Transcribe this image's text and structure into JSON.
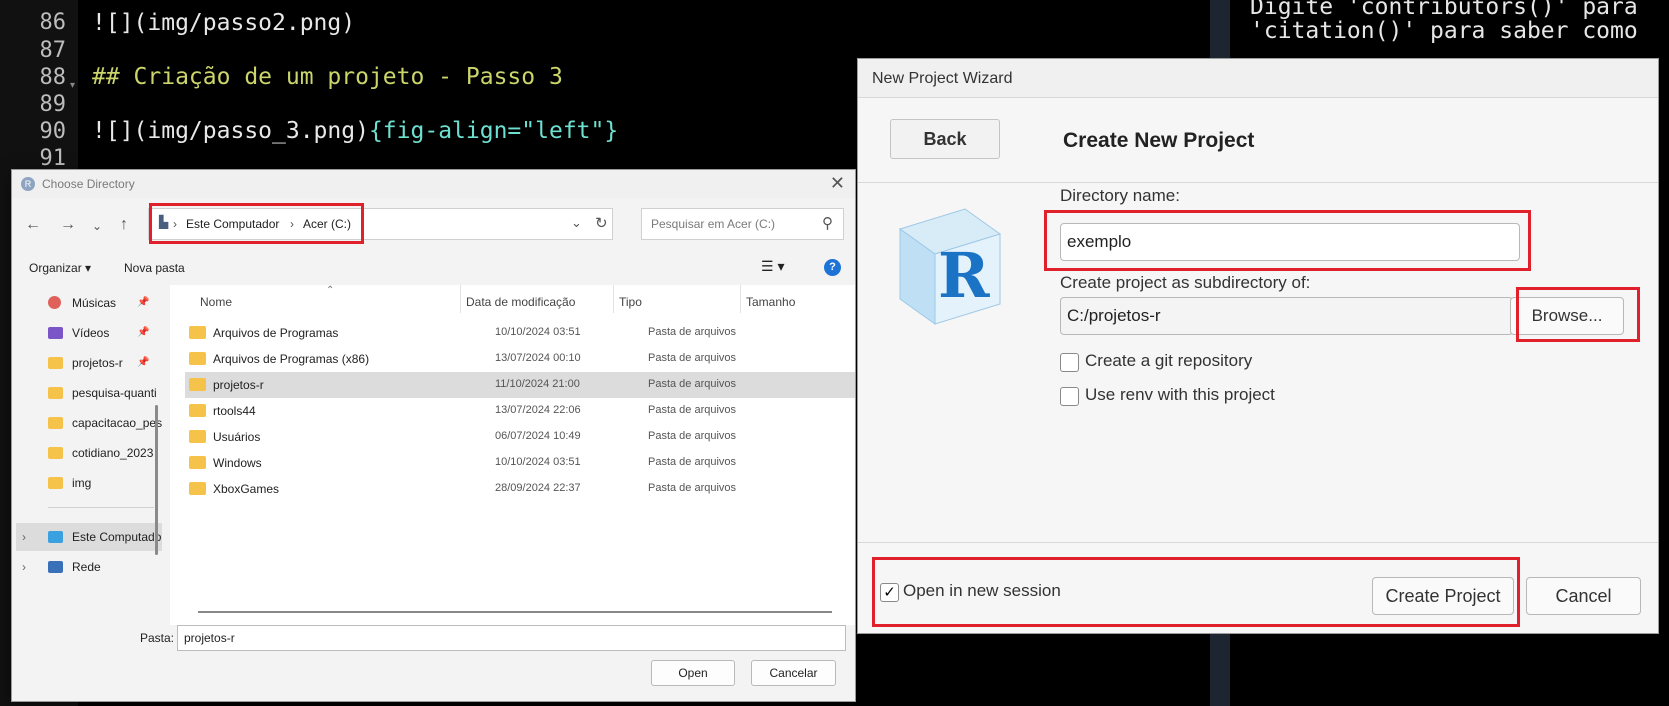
{
  "editor": {
    "lines": [
      {
        "num": "86",
        "text": "![](img/passo2.png)"
      },
      {
        "num": "87",
        "text": ""
      },
      {
        "num": "88",
        "text": "## Criação de um projeto - Passo 3"
      },
      {
        "num": "89",
        "text": ""
      },
      {
        "num": "90",
        "text": "![](img/passo_3.png){fig-align=\"left\"}"
      },
      {
        "num": "91",
        "text": ""
      }
    ],
    "line90_part1": "![](img/passo_3.png)",
    "line90_part2": "{fig-align=\"left\"}"
  },
  "console": {
    "line1": "Digite 'contributors()' para",
    "line2": "'citation()' para saber como"
  },
  "choose_directory": {
    "title": "Choose Directory",
    "breadcrumb": [
      "Este Computador",
      "Acer (C:)"
    ],
    "search_placeholder": "Pesquisar em Acer (C:)",
    "toolbar": {
      "organize": "Organizar ▾",
      "new_folder": "Nova pasta"
    },
    "nav_items": [
      {
        "label": "Músicas",
        "pinned": true
      },
      {
        "label": "Vídeos",
        "pinned": true
      },
      {
        "label": "projetos-r",
        "pinned": true
      },
      {
        "label": "pesquisa-quanti",
        "pinned": false
      },
      {
        "label": "capacitacao_pes",
        "pinned": false
      },
      {
        "label": "cotidiano_2023",
        "pinned": false
      },
      {
        "label": "img",
        "pinned": false
      },
      {
        "label": "Este Computador",
        "pinned": false
      },
      {
        "label": "Rede",
        "pinned": false
      }
    ],
    "columns": [
      "Nome",
      "Data de modificação",
      "Tipo",
      "Tamanho"
    ],
    "rows": [
      {
        "name": "Arquivos de Programas",
        "date": "10/10/2024 03:51",
        "type": "Pasta de arquivos"
      },
      {
        "name": "Arquivos de Programas (x86)",
        "date": "13/07/2024 00:10",
        "type": "Pasta de arquivos"
      },
      {
        "name": "projetos-r",
        "date": "11/10/2024 21:00",
        "type": "Pasta de arquivos"
      },
      {
        "name": "rtools44",
        "date": "13/07/2024 22:06",
        "type": "Pasta de arquivos"
      },
      {
        "name": "Usuários",
        "date": "06/07/2024 10:49",
        "type": "Pasta de arquivos"
      },
      {
        "name": "Windows",
        "date": "10/10/2024 03:51",
        "type": "Pasta de arquivos"
      },
      {
        "name": "XboxGames",
        "date": "28/09/2024 22:37",
        "type": "Pasta de arquivos"
      }
    ],
    "selected_row": "projetos-r",
    "folder_label": "Pasta:",
    "folder_value": "projetos-r",
    "open_button": "Open",
    "cancel_button": "Cancelar"
  },
  "wizard": {
    "title": "New Project Wizard",
    "back_button": "Back",
    "heading": "Create New Project",
    "directory_name_label": "Directory name:",
    "directory_name_value": "exemplo",
    "subdirectory_label": "Create project as subdirectory of:",
    "subdirectory_value": "C:/projetos-r",
    "browse_button": "Browse...",
    "git_checkbox_label": "Create a git repository",
    "git_checked": false,
    "renv_checkbox_label": "Use renv with this project",
    "renv_checked": false,
    "new_session_label": "Open in new session",
    "new_session_checked": true,
    "create_button": "Create Project",
    "cancel_button": "Cancel"
  },
  "colors": {
    "highlight": "#e0202a",
    "heading_code": "#cbd56a",
    "accent_blue": "#1d73d6"
  }
}
